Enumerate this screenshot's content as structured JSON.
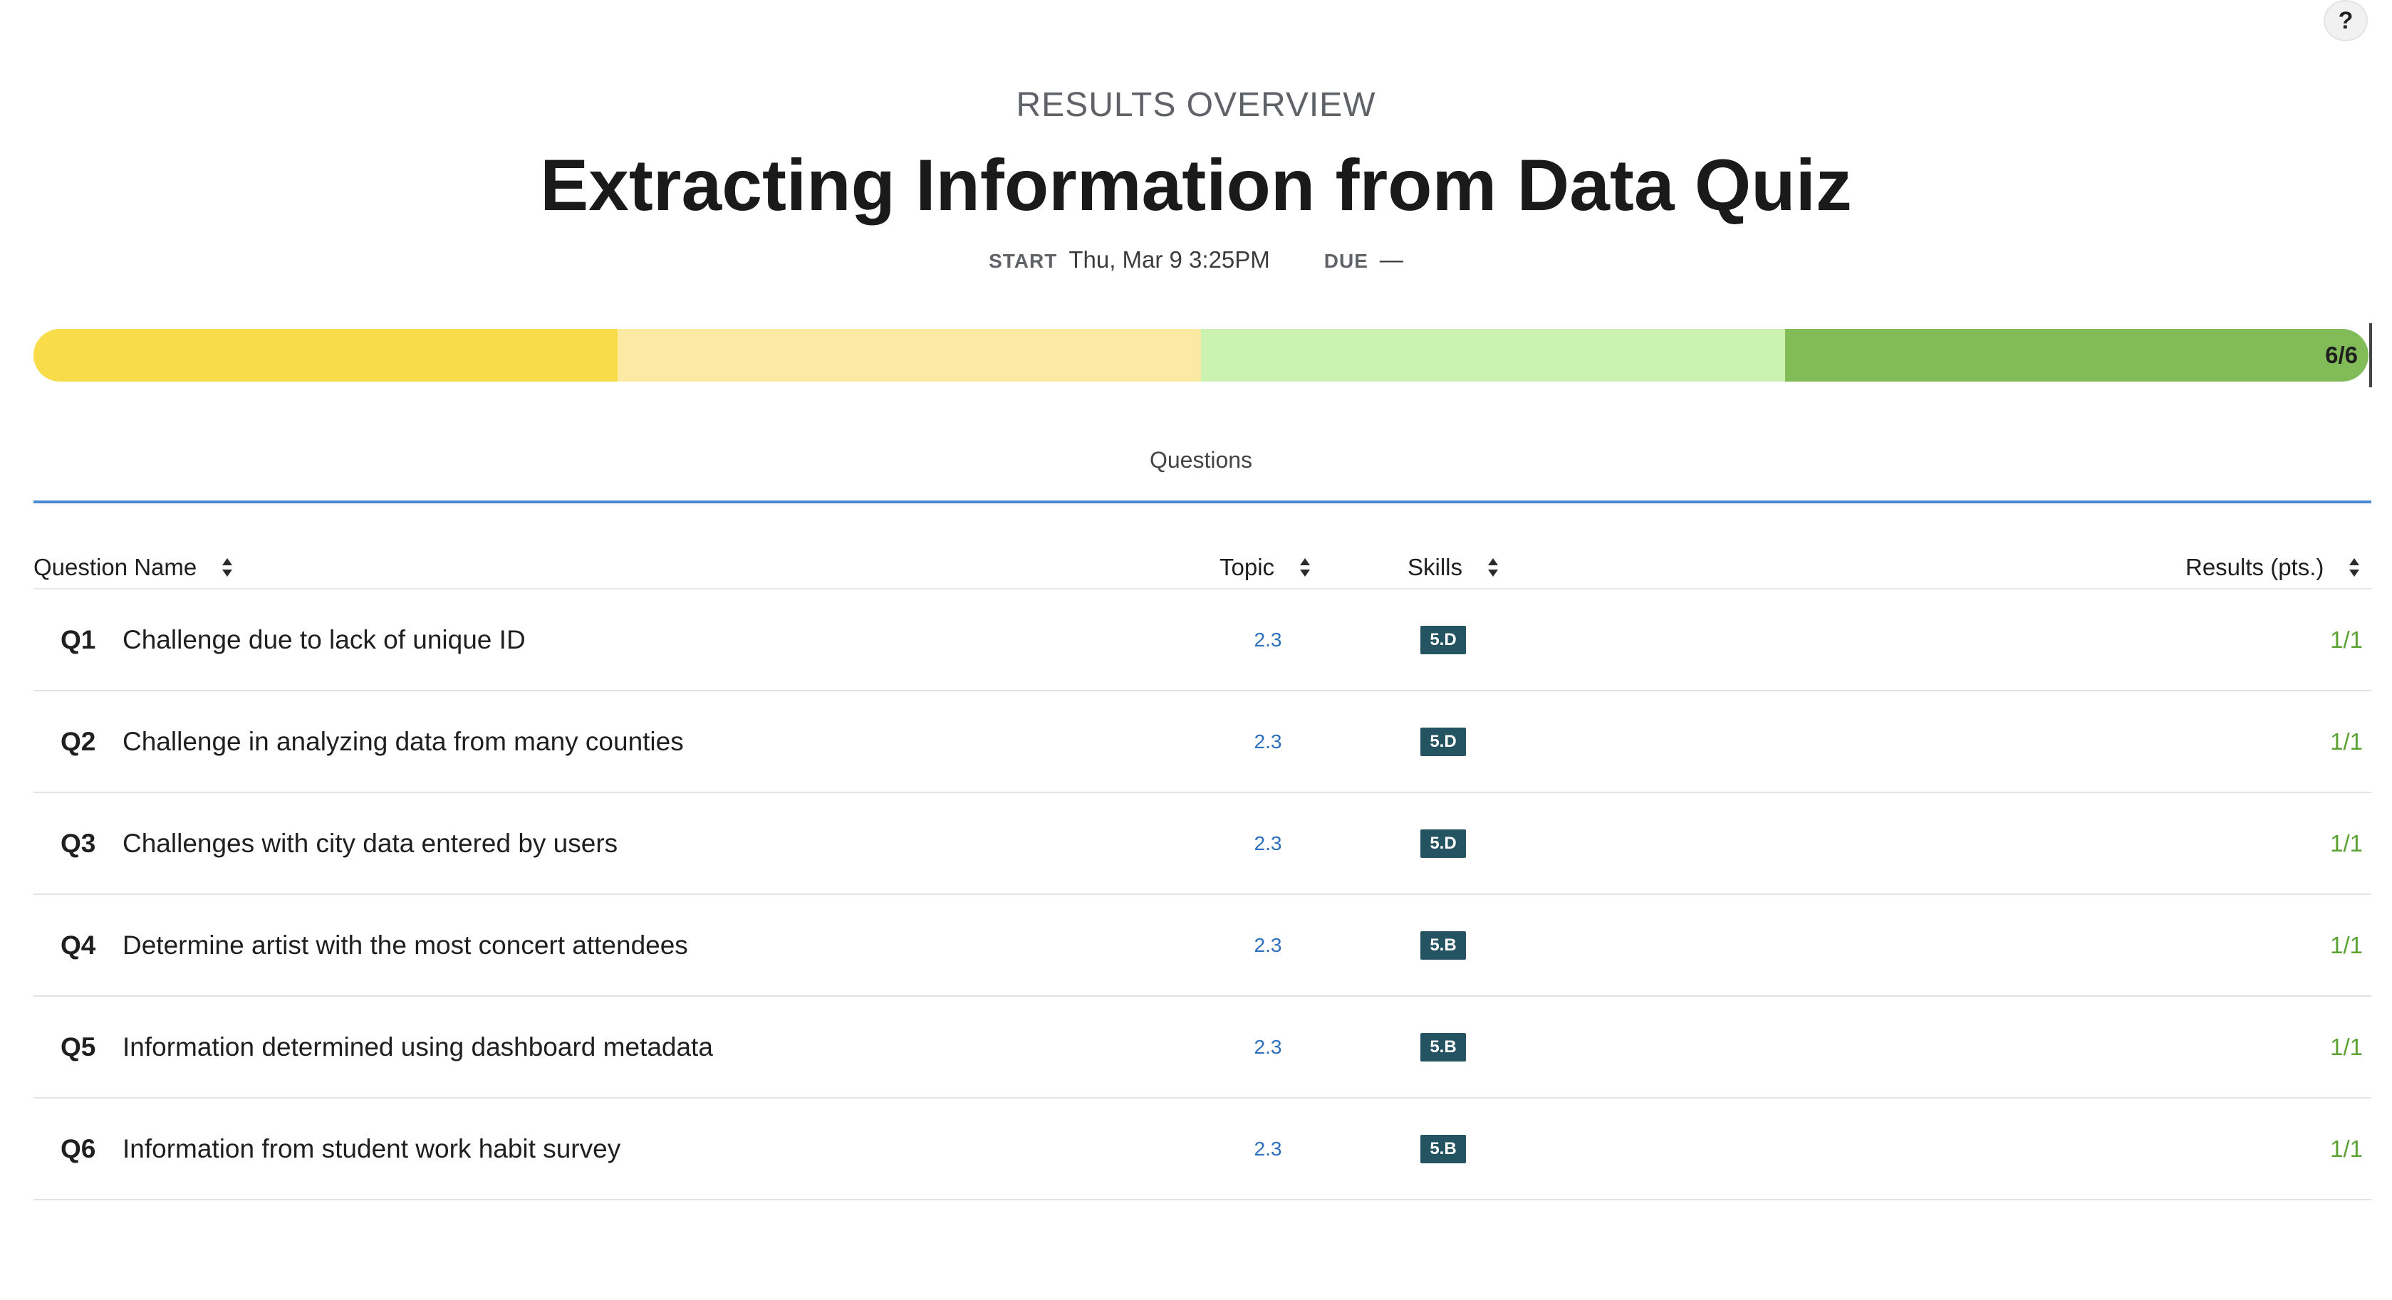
{
  "help": {
    "label": "?"
  },
  "header": {
    "overline": "RESULTS OVERVIEW",
    "title": "Extracting Information from Data Quiz",
    "start_label": "START",
    "start_value": "Thu, Mar 9 3:25PM",
    "due_label": "DUE",
    "due_value": "—"
  },
  "progress": {
    "label": "6/6",
    "score": 6,
    "total": 6,
    "segment_colors": [
      "#f9dc4a",
      "#fbe9a4",
      "#ccf2b1",
      "#82bc58"
    ]
  },
  "tabs": [
    {
      "label": "Questions",
      "active": true
    }
  ],
  "table": {
    "headers": {
      "name": "Question Name",
      "topic": "Topic",
      "skills": "Skills",
      "results": "Results (pts.)"
    },
    "rows": [
      {
        "num": "Q1",
        "name": "Challenge due to lack of unique ID",
        "topic": "2.3",
        "skill": "5.D",
        "result": "1/1"
      },
      {
        "num": "Q2",
        "name": "Challenge in analyzing data from many counties",
        "topic": "2.3",
        "skill": "5.D",
        "result": "1/1"
      },
      {
        "num": "Q3",
        "name": "Challenges with city data entered by users",
        "topic": "2.3",
        "skill": "5.D",
        "result": "1/1"
      },
      {
        "num": "Q4",
        "name": "Determine artist with the most concert attendees",
        "topic": "2.3",
        "skill": "5.B",
        "result": "1/1"
      },
      {
        "num": "Q5",
        "name": "Information determined using dashboard metadata",
        "topic": "2.3",
        "skill": "5.B",
        "result": "1/1"
      },
      {
        "num": "Q6",
        "name": "Information from student work habit survey",
        "topic": "2.3",
        "skill": "5.B",
        "result": "1/1"
      }
    ]
  },
  "colors": {
    "accent_line": "#4a8ad4",
    "topic_link": "#2b6fbe",
    "skill_badge": "#245361",
    "result_correct": "#5aa232"
  },
  "icons": {
    "sort": "sort-icon",
    "help": "help-icon"
  }
}
